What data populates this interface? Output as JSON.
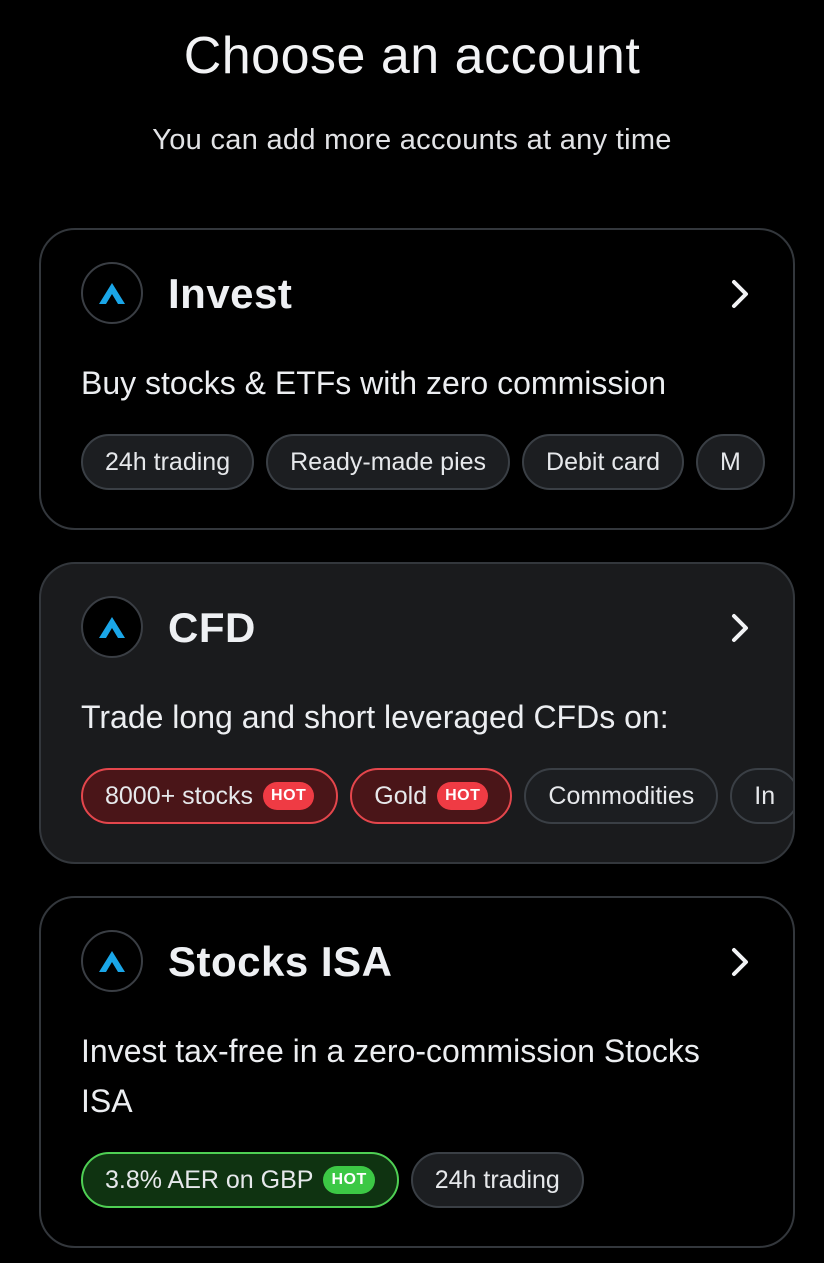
{
  "header": {
    "title": "Choose an account",
    "subtitle": "You can add more accounts at any time"
  },
  "colors": {
    "accent_logo": "#1aa6e8",
    "hot_red": "#ef3b44",
    "hot_green": "#3cc845"
  },
  "accounts": [
    {
      "title": "Invest",
      "description": "Buy stocks & ETFs with zero commission",
      "chips": [
        {
          "label": "24h trading"
        },
        {
          "label": "Ready-made pies"
        },
        {
          "label": "Debit card"
        },
        {
          "label": "M"
        }
      ]
    },
    {
      "title": "CFD",
      "description": "Trade long and short leveraged CFDs on:",
      "chips": [
        {
          "label": "8000+ stocks",
          "badge": "HOT"
        },
        {
          "label": "Gold",
          "badge": "HOT"
        },
        {
          "label": "Commodities"
        },
        {
          "label": "In"
        }
      ]
    },
    {
      "title": "Stocks ISA",
      "description": "Invest tax-free in a zero-commission Stocks ISA",
      "chips": [
        {
          "label": "3.8% AER on GBP",
          "badge": "HOT"
        },
        {
          "label": "24h trading"
        }
      ]
    }
  ],
  "icons": {
    "logo": "trading212-logo-icon",
    "chevron": "chevron-right-icon"
  }
}
